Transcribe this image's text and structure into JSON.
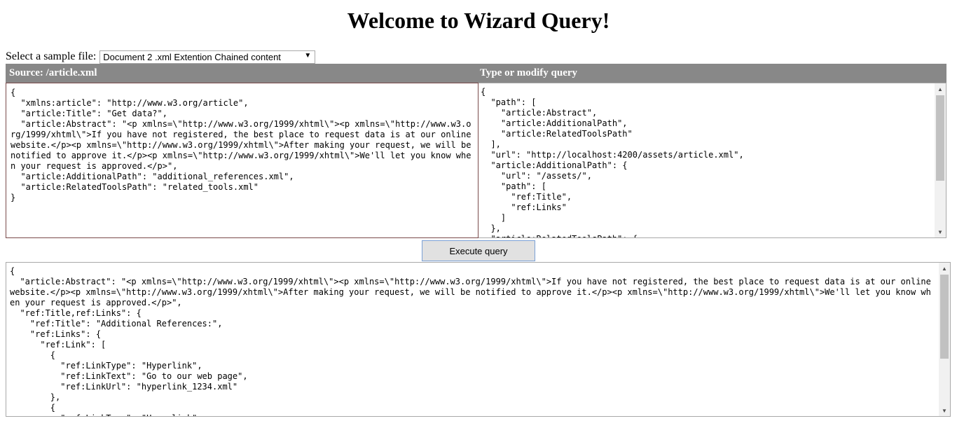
{
  "page": {
    "title": "Welcome to Wizard Query!"
  },
  "sample": {
    "label": "Select a sample file:",
    "selected": "Document 2 .xml Extention Chained content"
  },
  "panels": {
    "source_header": "Source: /article.xml",
    "query_header": "Type or modify query"
  },
  "source_text": "{\n  \"xmlns:article\": \"http://www.w3.org/article\",\n  \"article:Title\": \"Get data?\",\n  \"article:Abstract\": \"<p xmlns=\\\"http://www.w3.org/1999/xhtml\\\"><p xmlns=\\\"http://www.w3.org/1999/xhtml\\\">If you have not registered, the best place to request data is at our online website.</p><p xmlns=\\\"http://www.w3.org/1999/xhtml\\\">After making your request, we will be notified to approve it.</p><p xmlns=\\\"http://www.w3.org/1999/xhtml\\\">We'll let you know when your request is approved.</p>\",\n  \"article:AdditionalPath\": \"additional_references.xml\",\n  \"article:RelatedToolsPath\": \"related_tools.xml\"\n}",
  "query_text": "{\n  \"path\": [\n    \"article:Abstract\",\n    \"article:AdditionalPath\",\n    \"article:RelatedToolsPath\"\n  ],\n  \"url\": \"http://localhost:4200/assets/article.xml\",\n  \"article:AdditionalPath\": {\n    \"url\": \"/assets/\",\n    \"path\": [\n      \"ref:Title\",\n      \"ref:Links\"\n    ]\n  },\n  \"article:RelatedToolsPath\": {",
  "execute_button": "Execute query",
  "result_text": "{\n  \"article:Abstract\": \"<p xmlns=\\\"http://www.w3.org/1999/xhtml\\\"><p xmlns=\\\"http://www.w3.org/1999/xhtml\\\">If you have not registered, the best place to request data is at our online website.</p><p xmlns=\\\"http://www.w3.org/1999/xhtml\\\">After making your request, we will be notified to approve it.</p><p xmlns=\\\"http://www.w3.org/1999/xhtml\\\">We'll let you know when your request is approved.</p>\",\n  \"ref:Title,ref:Links\": {\n    \"ref:Title\": \"Additional References:\",\n    \"ref:Links\": {\n      \"ref:Link\": [\n        {\n          \"ref:LinkType\": \"Hyperlink\",\n          \"ref:LinkText\": \"Go to our web page\",\n          \"ref:LinkUrl\": \"hyperlink_1234.xml\"\n        },\n        {\n          \"ref:LinkType\": \"Hyperlink\",",
  "icons": {
    "select_arrow": "dropdown-arrow-icon",
    "scroll_up": "scroll-up-arrow-icon",
    "scroll_down": "scroll-down-arrow-icon"
  }
}
